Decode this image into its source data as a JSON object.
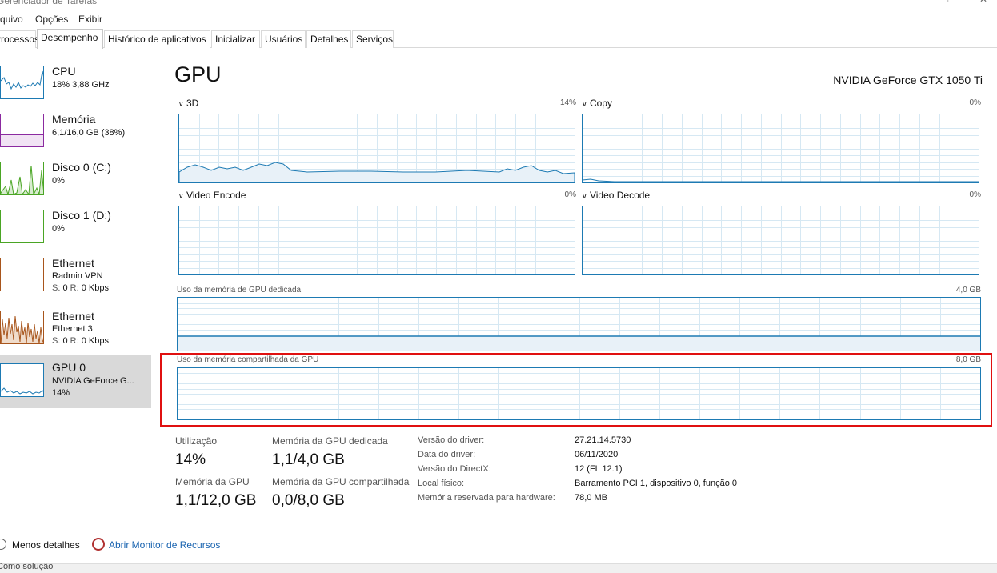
{
  "window": {
    "title": "Gerenciador de Tarefas"
  },
  "menu": {
    "arquivo": "Arquivo",
    "opcoes": "Opções",
    "exibir": "Exibir"
  },
  "tabs": [
    "Processos",
    "Desempenho",
    "Histórico de aplicativos",
    "Inicializar",
    "Usuários",
    "Detalhes",
    "Serviços"
  ],
  "sidebar": {
    "cpu": {
      "name": "CPU",
      "sub": "18%  3,88 GHz",
      "color": "#1d7ab3"
    },
    "memory": {
      "name": "Memória",
      "sub": "6,1/16,0 GB (38%)",
      "color": "#8b2aa0"
    },
    "disk0": {
      "name": "Disco 0 (C:)",
      "sub": "0%",
      "color": "#4aa524"
    },
    "disk1": {
      "name": "Disco 1 (D:)",
      "sub": "0%",
      "color": "#4aa524"
    },
    "eth1": {
      "name": "Ethernet",
      "adapter": "Radmin VPN",
      "s_label": "S:",
      "s_value": "0",
      "r_label": "R:",
      "r_value": "0 Kbps",
      "color": "#a8551c"
    },
    "eth2": {
      "name": "Ethernet",
      "adapter": "Ethernet 3",
      "s_label": "S:",
      "s_value": "0",
      "r_label": "R:",
      "r_value": "0 Kbps",
      "color": "#a8551c"
    },
    "gpu0": {
      "name": "GPU 0",
      "model": "NVIDIA GeForce G...",
      "pct": "14%",
      "color": "#1d7ab3"
    }
  },
  "main": {
    "title": "GPU",
    "model": "NVIDIA GeForce GTX 1050 Ti",
    "engines": [
      {
        "name": "3D",
        "pct": "14%"
      },
      {
        "name": "Copy",
        "pct": "0%"
      },
      {
        "name": "Video Encode",
        "pct": "0%"
      },
      {
        "name": "Video Decode",
        "pct": "0%"
      }
    ],
    "dedicated_mem": {
      "label": "Uso da memória de GPU dedicada",
      "max": "4,0 GB"
    },
    "shared_mem": {
      "label": "Uso da memória compartilhada da GPU",
      "max": "8,0 GB"
    }
  },
  "stats": {
    "utilization": {
      "label": "Utilização",
      "value": "14%"
    },
    "dedicated": {
      "label": "Memória da GPU dedicada",
      "value": "1,1/4,0 GB"
    },
    "gpu_memory": {
      "label": "Memória da GPU",
      "value": "1,1/12,0 GB"
    },
    "shared": {
      "label": "Memória da GPU compartilhada",
      "value": "0,0/8,0 GB"
    }
  },
  "properties": [
    {
      "label": "Versão do driver:",
      "value": "27.21.14.5730"
    },
    {
      "label": "Data do driver:",
      "value": "06/11/2020"
    },
    {
      "label": "Versão do DirectX:",
      "value": "12 (FL 12.1)"
    },
    {
      "label": "Local físico:",
      "value": "Barramento PCI 1, dispositivo 0, função 0"
    },
    {
      "label": "Memória reservada para hardware:",
      "value": "78,0 MB"
    }
  ],
  "footer": {
    "fewer_details": "Menos detalhes",
    "resource_monitor": "Abrir Monitor de Recursos"
  },
  "taskbar": {
    "text": "Como solução"
  },
  "accent": {
    "gpu_blue": "#1d7ab3",
    "highlight_red": "#e01010"
  }
}
